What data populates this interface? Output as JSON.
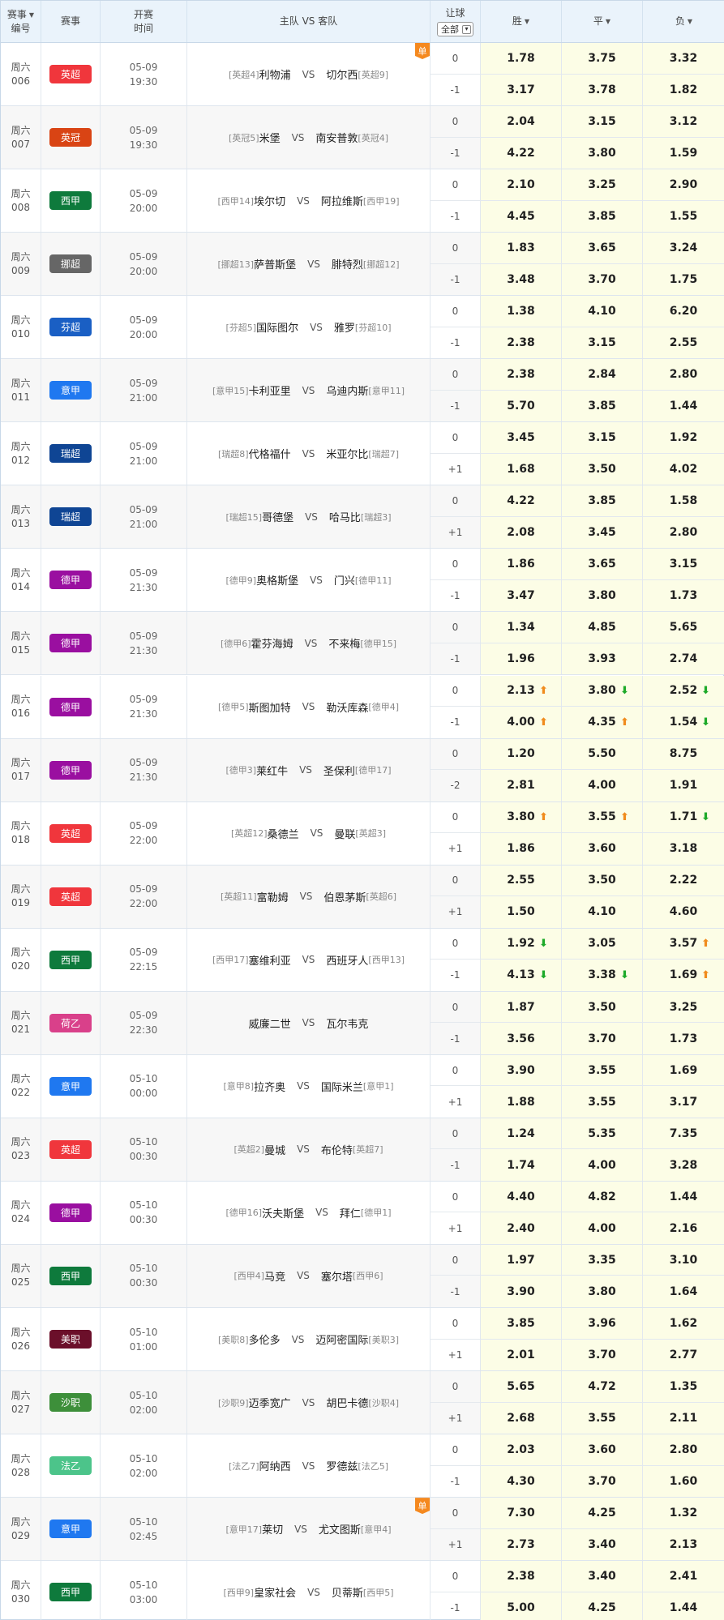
{
  "header": {
    "col_id": "赛事\n编号",
    "col_league": "赛事",
    "col_time": "开赛\n时间",
    "col_match": "主队 VS 客队",
    "col_handicap": "让球",
    "handicap_filter": "全部",
    "col_win": "胜",
    "col_draw": "平",
    "col_lose": "负"
  },
  "vs_label": "VS",
  "dan_label": "单",
  "colors": {
    "up_arrow": "#f08c1e",
    "down_arrow": "#1eaa2a",
    "odds_bg": "#fcfde6"
  },
  "matches": [
    {
      "day": "周六",
      "num": "006",
      "league": "英超",
      "color": "#f0363c",
      "date": "05-09",
      "time": "19:30",
      "home_tag": "[英超4]",
      "home": "利物浦",
      "away": "切尔西",
      "away_tag": "[英超9]",
      "dan": true,
      "h1": "0",
      "h2": "-1",
      "o1": [
        "1.78",
        "3.75",
        "3.32"
      ],
      "o2": [
        "3.17",
        "3.78",
        "1.82"
      ],
      "t1": [
        "",
        "",
        ""
      ],
      "t2": [
        "",
        "",
        ""
      ]
    },
    {
      "day": "周六",
      "num": "007",
      "league": "英冠",
      "color": "#d94414",
      "date": "05-09",
      "time": "19:30",
      "home_tag": "[英冠5]",
      "home": "米堡",
      "away": "南安普敦",
      "away_tag": "[英冠4]",
      "dan": false,
      "h1": "0",
      "h2": "-1",
      "o1": [
        "2.04",
        "3.15",
        "3.12"
      ],
      "o2": [
        "4.22",
        "3.80",
        "1.59"
      ],
      "t1": [
        "",
        "",
        ""
      ],
      "t2": [
        "",
        "",
        ""
      ]
    },
    {
      "day": "周六",
      "num": "008",
      "league": "西甲",
      "color": "#0e7a3c",
      "date": "05-09",
      "time": "20:00",
      "home_tag": "[西甲14]",
      "home": "埃尔切",
      "away": "阿拉维斯",
      "away_tag": "[西甲19]",
      "dan": false,
      "h1": "0",
      "h2": "-1",
      "o1": [
        "2.10",
        "3.25",
        "2.90"
      ],
      "o2": [
        "4.45",
        "3.85",
        "1.55"
      ],
      "t1": [
        "",
        "",
        ""
      ],
      "t2": [
        "",
        "",
        ""
      ]
    },
    {
      "day": "周六",
      "num": "009",
      "league": "挪超",
      "color": "#666666",
      "date": "05-09",
      "time": "20:00",
      "home_tag": "[挪超13]",
      "home": "萨普斯堡",
      "away": "腓特烈",
      "away_tag": "[挪超12]",
      "dan": false,
      "h1": "0",
      "h2": "-1",
      "o1": [
        "1.83",
        "3.65",
        "3.24"
      ],
      "o2": [
        "3.48",
        "3.70",
        "1.75"
      ],
      "t1": [
        "",
        "",
        ""
      ],
      "t2": [
        "",
        "",
        ""
      ]
    },
    {
      "day": "周六",
      "num": "010",
      "league": "芬超",
      "color": "#1a5fc4",
      "date": "05-09",
      "time": "20:00",
      "home_tag": "[芬超5]",
      "home": "国际图尔",
      "away": "雅罗",
      "away_tag": "[芬超10]",
      "dan": false,
      "h1": "0",
      "h2": "-1",
      "o1": [
        "1.38",
        "4.10",
        "6.20"
      ],
      "o2": [
        "2.38",
        "3.15",
        "2.55"
      ],
      "t1": [
        "",
        "",
        ""
      ],
      "t2": [
        "",
        "",
        ""
      ]
    },
    {
      "day": "周六",
      "num": "011",
      "league": "意甲",
      "color": "#1f78f0",
      "date": "05-09",
      "time": "21:00",
      "home_tag": "[意甲15]",
      "home": "卡利亚里",
      "away": "乌迪内斯",
      "away_tag": "[意甲11]",
      "dan": false,
      "h1": "0",
      "h2": "-1",
      "o1": [
        "2.38",
        "2.84",
        "2.80"
      ],
      "o2": [
        "5.70",
        "3.85",
        "1.44"
      ],
      "t1": [
        "",
        "",
        ""
      ],
      "t2": [
        "",
        "",
        ""
      ]
    },
    {
      "day": "周六",
      "num": "012",
      "league": "瑞超",
      "color": "#0f4594",
      "date": "05-09",
      "time": "21:00",
      "home_tag": "[瑞超8]",
      "home": "代格福什",
      "away": "米亚尔比",
      "away_tag": "[瑞超7]",
      "dan": false,
      "h1": "0",
      "h2": "+1",
      "o1": [
        "3.45",
        "3.15",
        "1.92"
      ],
      "o2": [
        "1.68",
        "3.50",
        "4.02"
      ],
      "t1": [
        "",
        "",
        ""
      ],
      "t2": [
        "",
        "",
        ""
      ]
    },
    {
      "day": "周六",
      "num": "013",
      "league": "瑞超",
      "color": "#0f4594",
      "date": "05-09",
      "time": "21:00",
      "home_tag": "[瑞超15]",
      "home": "哥德堡",
      "away": "哈马比",
      "away_tag": "[瑞超3]",
      "dan": false,
      "h1": "0",
      "h2": "+1",
      "o1": [
        "4.22",
        "3.85",
        "1.58"
      ],
      "o2": [
        "2.08",
        "3.45",
        "2.80"
      ],
      "t1": [
        "",
        "",
        ""
      ],
      "t2": [
        "",
        "",
        ""
      ]
    },
    {
      "day": "周六",
      "num": "014",
      "league": "德甲",
      "color": "#9a0fa0",
      "date": "05-09",
      "time": "21:30",
      "home_tag": "[德甲9]",
      "home": "奥格斯堡",
      "away": "门兴",
      "away_tag": "[德甲11]",
      "dan": false,
      "h1": "0",
      "h2": "-1",
      "o1": [
        "1.86",
        "3.65",
        "3.15"
      ],
      "o2": [
        "3.47",
        "3.80",
        "1.73"
      ],
      "t1": [
        "",
        "",
        ""
      ],
      "t2": [
        "",
        "",
        ""
      ]
    },
    {
      "day": "周六",
      "num": "015",
      "league": "德甲",
      "color": "#9a0fa0",
      "date": "05-09",
      "time": "21:30",
      "home_tag": "[德甲6]",
      "home": "霍芬海姆",
      "away": "不来梅",
      "away_tag": "[德甲15]",
      "dan": false,
      "h1": "0",
      "h2": "-1",
      "o1": [
        "1.34",
        "4.85",
        "5.65"
      ],
      "o2": [
        "1.96",
        "3.93",
        "2.74"
      ],
      "t1": [
        "",
        "",
        ""
      ],
      "t2": [
        "",
        "",
        ""
      ]
    },
    {
      "day": "周六",
      "num": "016",
      "league": "德甲",
      "color": "#9a0fa0",
      "date": "05-09",
      "time": "21:30",
      "home_tag": "[德甲5]",
      "home": "斯图加特",
      "away": "勒沃库森",
      "away_tag": "[德甲4]",
      "dan": false,
      "h1": "0",
      "h2": "-1",
      "o1": [
        "2.13",
        "3.80",
        "2.52"
      ],
      "o2": [
        "4.00",
        "4.35",
        "1.54"
      ],
      "t1": [
        "up",
        "down",
        "down"
      ],
      "t2": [
        "up",
        "up",
        "down"
      ]
    },
    {
      "day": "周六",
      "num": "017",
      "league": "德甲",
      "color": "#9a0fa0",
      "date": "05-09",
      "time": "21:30",
      "home_tag": "[德甲3]",
      "home": "莱红牛",
      "away": "圣保利",
      "away_tag": "[德甲17]",
      "dan": false,
      "h1": "0",
      "h2": "-2",
      "o1": [
        "1.20",
        "5.50",
        "8.75"
      ],
      "o2": [
        "2.81",
        "4.00",
        "1.91"
      ],
      "t1": [
        "",
        "",
        ""
      ],
      "t2": [
        "",
        "",
        ""
      ]
    },
    {
      "day": "周六",
      "num": "018",
      "league": "英超",
      "color": "#f0363c",
      "date": "05-09",
      "time": "22:00",
      "home_tag": "[英超12]",
      "home": "桑德兰",
      "away": "曼联",
      "away_tag": "[英超3]",
      "dan": false,
      "h1": "0",
      "h2": "+1",
      "o1": [
        "3.80",
        "3.55",
        "1.71"
      ],
      "o2": [
        "1.86",
        "3.60",
        "3.18"
      ],
      "t1": [
        "up",
        "up",
        "down"
      ],
      "t2": [
        "",
        "",
        ""
      ]
    },
    {
      "day": "周六",
      "num": "019",
      "league": "英超",
      "color": "#f0363c",
      "date": "05-09",
      "time": "22:00",
      "home_tag": "[英超11]",
      "home": "富勒姆",
      "away": "伯恩茅斯",
      "away_tag": "[英超6]",
      "dan": false,
      "h1": "0",
      "h2": "+1",
      "o1": [
        "2.55",
        "3.50",
        "2.22"
      ],
      "o2": [
        "1.50",
        "4.10",
        "4.60"
      ],
      "t1": [
        "",
        "",
        ""
      ],
      "t2": [
        "",
        "",
        ""
      ]
    },
    {
      "day": "周六",
      "num": "020",
      "league": "西甲",
      "color": "#0e7a3c",
      "date": "05-09",
      "time": "22:15",
      "home_tag": "[西甲17]",
      "home": "塞维利亚",
      "away": "西班牙人",
      "away_tag": "[西甲13]",
      "dan": false,
      "h1": "0",
      "h2": "-1",
      "o1": [
        "1.92",
        "3.05",
        "3.57"
      ],
      "o2": [
        "4.13",
        "3.38",
        "1.69"
      ],
      "t1": [
        "down",
        "",
        "up"
      ],
      "t2": [
        "down",
        "down",
        "up"
      ]
    },
    {
      "day": "周六",
      "num": "021",
      "league": "荷乙",
      "color": "#d9408a",
      "date": "05-09",
      "time": "22:30",
      "home_tag": "",
      "home": "威廉二世",
      "away": "瓦尔韦克",
      "away_tag": "",
      "dan": false,
      "h1": "0",
      "h2": "-1",
      "o1": [
        "1.87",
        "3.50",
        "3.25"
      ],
      "o2": [
        "3.56",
        "3.70",
        "1.73"
      ],
      "t1": [
        "",
        "",
        ""
      ],
      "t2": [
        "",
        "",
        ""
      ]
    },
    {
      "day": "周六",
      "num": "022",
      "league": "意甲",
      "color": "#1f78f0",
      "date": "05-10",
      "time": "00:00",
      "home_tag": "[意甲8]",
      "home": "拉齐奥",
      "away": "国际米兰",
      "away_tag": "[意甲1]",
      "dan": false,
      "h1": "0",
      "h2": "+1",
      "o1": [
        "3.90",
        "3.55",
        "1.69"
      ],
      "o2": [
        "1.88",
        "3.55",
        "3.17"
      ],
      "t1": [
        "",
        "",
        ""
      ],
      "t2": [
        "",
        "",
        ""
      ]
    },
    {
      "day": "周六",
      "num": "023",
      "league": "英超",
      "color": "#f0363c",
      "date": "05-10",
      "time": "00:30",
      "home_tag": "[英超2]",
      "home": "曼城",
      "away": "布伦特",
      "away_tag": "[英超7]",
      "dan": false,
      "h1": "0",
      "h2": "-1",
      "o1": [
        "1.24",
        "5.35",
        "7.35"
      ],
      "o2": [
        "1.74",
        "4.00",
        "3.28"
      ],
      "t1": [
        "",
        "",
        ""
      ],
      "t2": [
        "",
        "",
        ""
      ]
    },
    {
      "day": "周六",
      "num": "024",
      "league": "德甲",
      "color": "#9a0fa0",
      "date": "05-10",
      "time": "00:30",
      "home_tag": "[德甲16]",
      "home": "沃夫斯堡",
      "away": "拜仁",
      "away_tag": "[德甲1]",
      "dan": false,
      "h1": "0",
      "h2": "+1",
      "o1": [
        "4.40",
        "4.82",
        "1.44"
      ],
      "o2": [
        "2.40",
        "4.00",
        "2.16"
      ],
      "t1": [
        "",
        "",
        ""
      ],
      "t2": [
        "",
        "",
        ""
      ]
    },
    {
      "day": "周六",
      "num": "025",
      "league": "西甲",
      "color": "#0e7a3c",
      "date": "05-10",
      "time": "00:30",
      "home_tag": "[西甲4]",
      "home": "马竞",
      "away": "塞尔塔",
      "away_tag": "[西甲6]",
      "dan": false,
      "h1": "0",
      "h2": "-1",
      "o1": [
        "1.97",
        "3.35",
        "3.10"
      ],
      "o2": [
        "3.90",
        "3.80",
        "1.64"
      ],
      "t1": [
        "",
        "",
        ""
      ],
      "t2": [
        "",
        "",
        ""
      ]
    },
    {
      "day": "周六",
      "num": "026",
      "league": "美职",
      "color": "#6b0f2a",
      "date": "05-10",
      "time": "01:00",
      "home_tag": "[美职8]",
      "home": "多伦多",
      "away": "迈阿密国际",
      "away_tag": "[美职3]",
      "dan": false,
      "h1": "0",
      "h2": "+1",
      "o1": [
        "3.85",
        "3.96",
        "1.62"
      ],
      "o2": [
        "2.01",
        "3.70",
        "2.77"
      ],
      "t1": [
        "",
        "",
        ""
      ],
      "t2": [
        "",
        "",
        ""
      ]
    },
    {
      "day": "周六",
      "num": "027",
      "league": "沙职",
      "color": "#3d8f3a",
      "date": "05-10",
      "time": "02:00",
      "home_tag": "[沙职9]",
      "home": "迈季宽广",
      "away": "胡巴卡德",
      "away_tag": "[沙职4]",
      "dan": false,
      "h1": "0",
      "h2": "+1",
      "o1": [
        "5.65",
        "4.72",
        "1.35"
      ],
      "o2": [
        "2.68",
        "3.55",
        "2.11"
      ],
      "t1": [
        "",
        "",
        ""
      ],
      "t2": [
        "",
        "",
        ""
      ]
    },
    {
      "day": "周六",
      "num": "028",
      "league": "法乙",
      "color": "#4cc48a",
      "date": "05-10",
      "time": "02:00",
      "home_tag": "[法乙7]",
      "home": "阿纳西",
      "away": "罗德兹",
      "away_tag": "[法乙5]",
      "dan": false,
      "h1": "0",
      "h2": "-1",
      "o1": [
        "2.03",
        "3.60",
        "2.80"
      ],
      "o2": [
        "4.30",
        "3.70",
        "1.60"
      ],
      "t1": [
        "",
        "",
        ""
      ],
      "t2": [
        "",
        "",
        ""
      ]
    },
    {
      "day": "周六",
      "num": "029",
      "league": "意甲",
      "color": "#1f78f0",
      "date": "05-10",
      "time": "02:45",
      "home_tag": "[意甲17]",
      "home": "莱切",
      "away": "尤文图斯",
      "away_tag": "[意甲4]",
      "dan": true,
      "h1": "0",
      "h2": "+1",
      "o1": [
        "7.30",
        "4.25",
        "1.32"
      ],
      "o2": [
        "2.73",
        "3.40",
        "2.13"
      ],
      "t1": [
        "",
        "",
        ""
      ],
      "t2": [
        "",
        "",
        ""
      ]
    },
    {
      "day": "周六",
      "num": "030",
      "league": "西甲",
      "color": "#0e7a3c",
      "date": "05-10",
      "time": "03:00",
      "home_tag": "[西甲9]",
      "home": "皇家社会",
      "away": "贝蒂斯",
      "away_tag": "[西甲5]",
      "dan": false,
      "h1": "0",
      "h2": "-1",
      "o1": [
        "2.38",
        "3.40",
        "2.41"
      ],
      "o2": [
        "5.00",
        "4.25",
        "1.44"
      ],
      "t1": [
        "",
        "",
        ""
      ],
      "t2": [
        "",
        "",
        ""
      ]
    }
  ]
}
